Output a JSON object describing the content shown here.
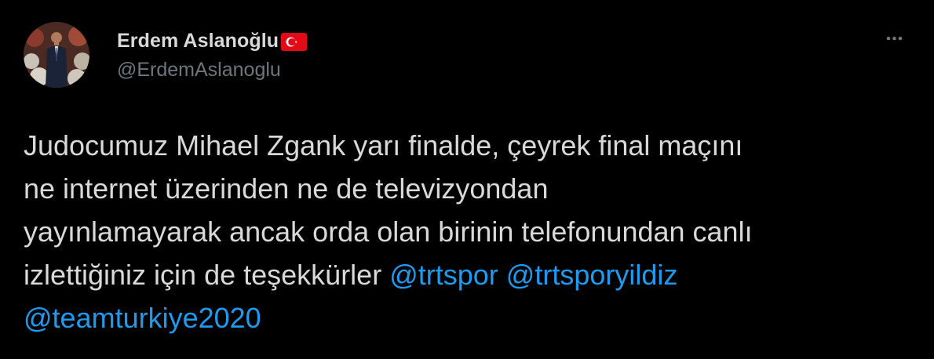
{
  "author": {
    "display_name": "Erdem Aslanoğlu",
    "handle": "@ErdemAslanoglu",
    "flag_icon": "turkey-flag-icon",
    "avatar_icon": "profile-photo"
  },
  "actions": {
    "more_icon": "more-horizontal-icon"
  },
  "tweet": {
    "lines": [
      "Judocumuz Mihael Zgank yarı finalde, çeyrek final maçını",
      "ne internet üzerinden ne de televizyondan",
      "yayınlamayarak ancak orda olan birinin telefonundan canlı",
      "izlettiğiniz için de teşekkürler "
    ],
    "mentions": [
      "@trtspor",
      "@trtsporyildiz",
      "@teamturkiye2020"
    ]
  },
  "colors": {
    "background": "#000000",
    "text": "#d9d9d9",
    "muted": "#6e767d",
    "link": "#1d9bf0",
    "flag_red": "#e30a17"
  }
}
